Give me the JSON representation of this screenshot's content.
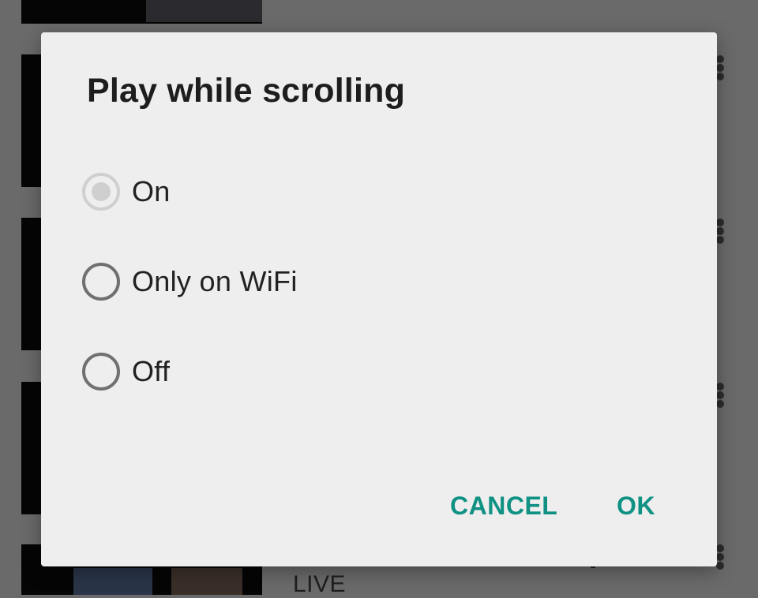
{
  "background": {
    "live_text": "LIVE"
  },
  "dialog": {
    "title": "Play while scrolling",
    "options": [
      {
        "label": "On",
        "checked": true
      },
      {
        "label": "Only on WiFi",
        "checked": false
      },
      {
        "label": "Off",
        "checked": false
      }
    ],
    "cancel_label": "CANCEL",
    "ok_label": "OK"
  },
  "colors": {
    "accent": "#0f9183",
    "dialog_bg": "#eeeeee",
    "scrim": "#6a6a6a",
    "radio_disabled": "#cfcfcf",
    "radio_unchecked": "#707070"
  },
  "icons": [
    "radio-selected-icon",
    "radio-unselected-icon",
    "more-vert-icon"
  ]
}
